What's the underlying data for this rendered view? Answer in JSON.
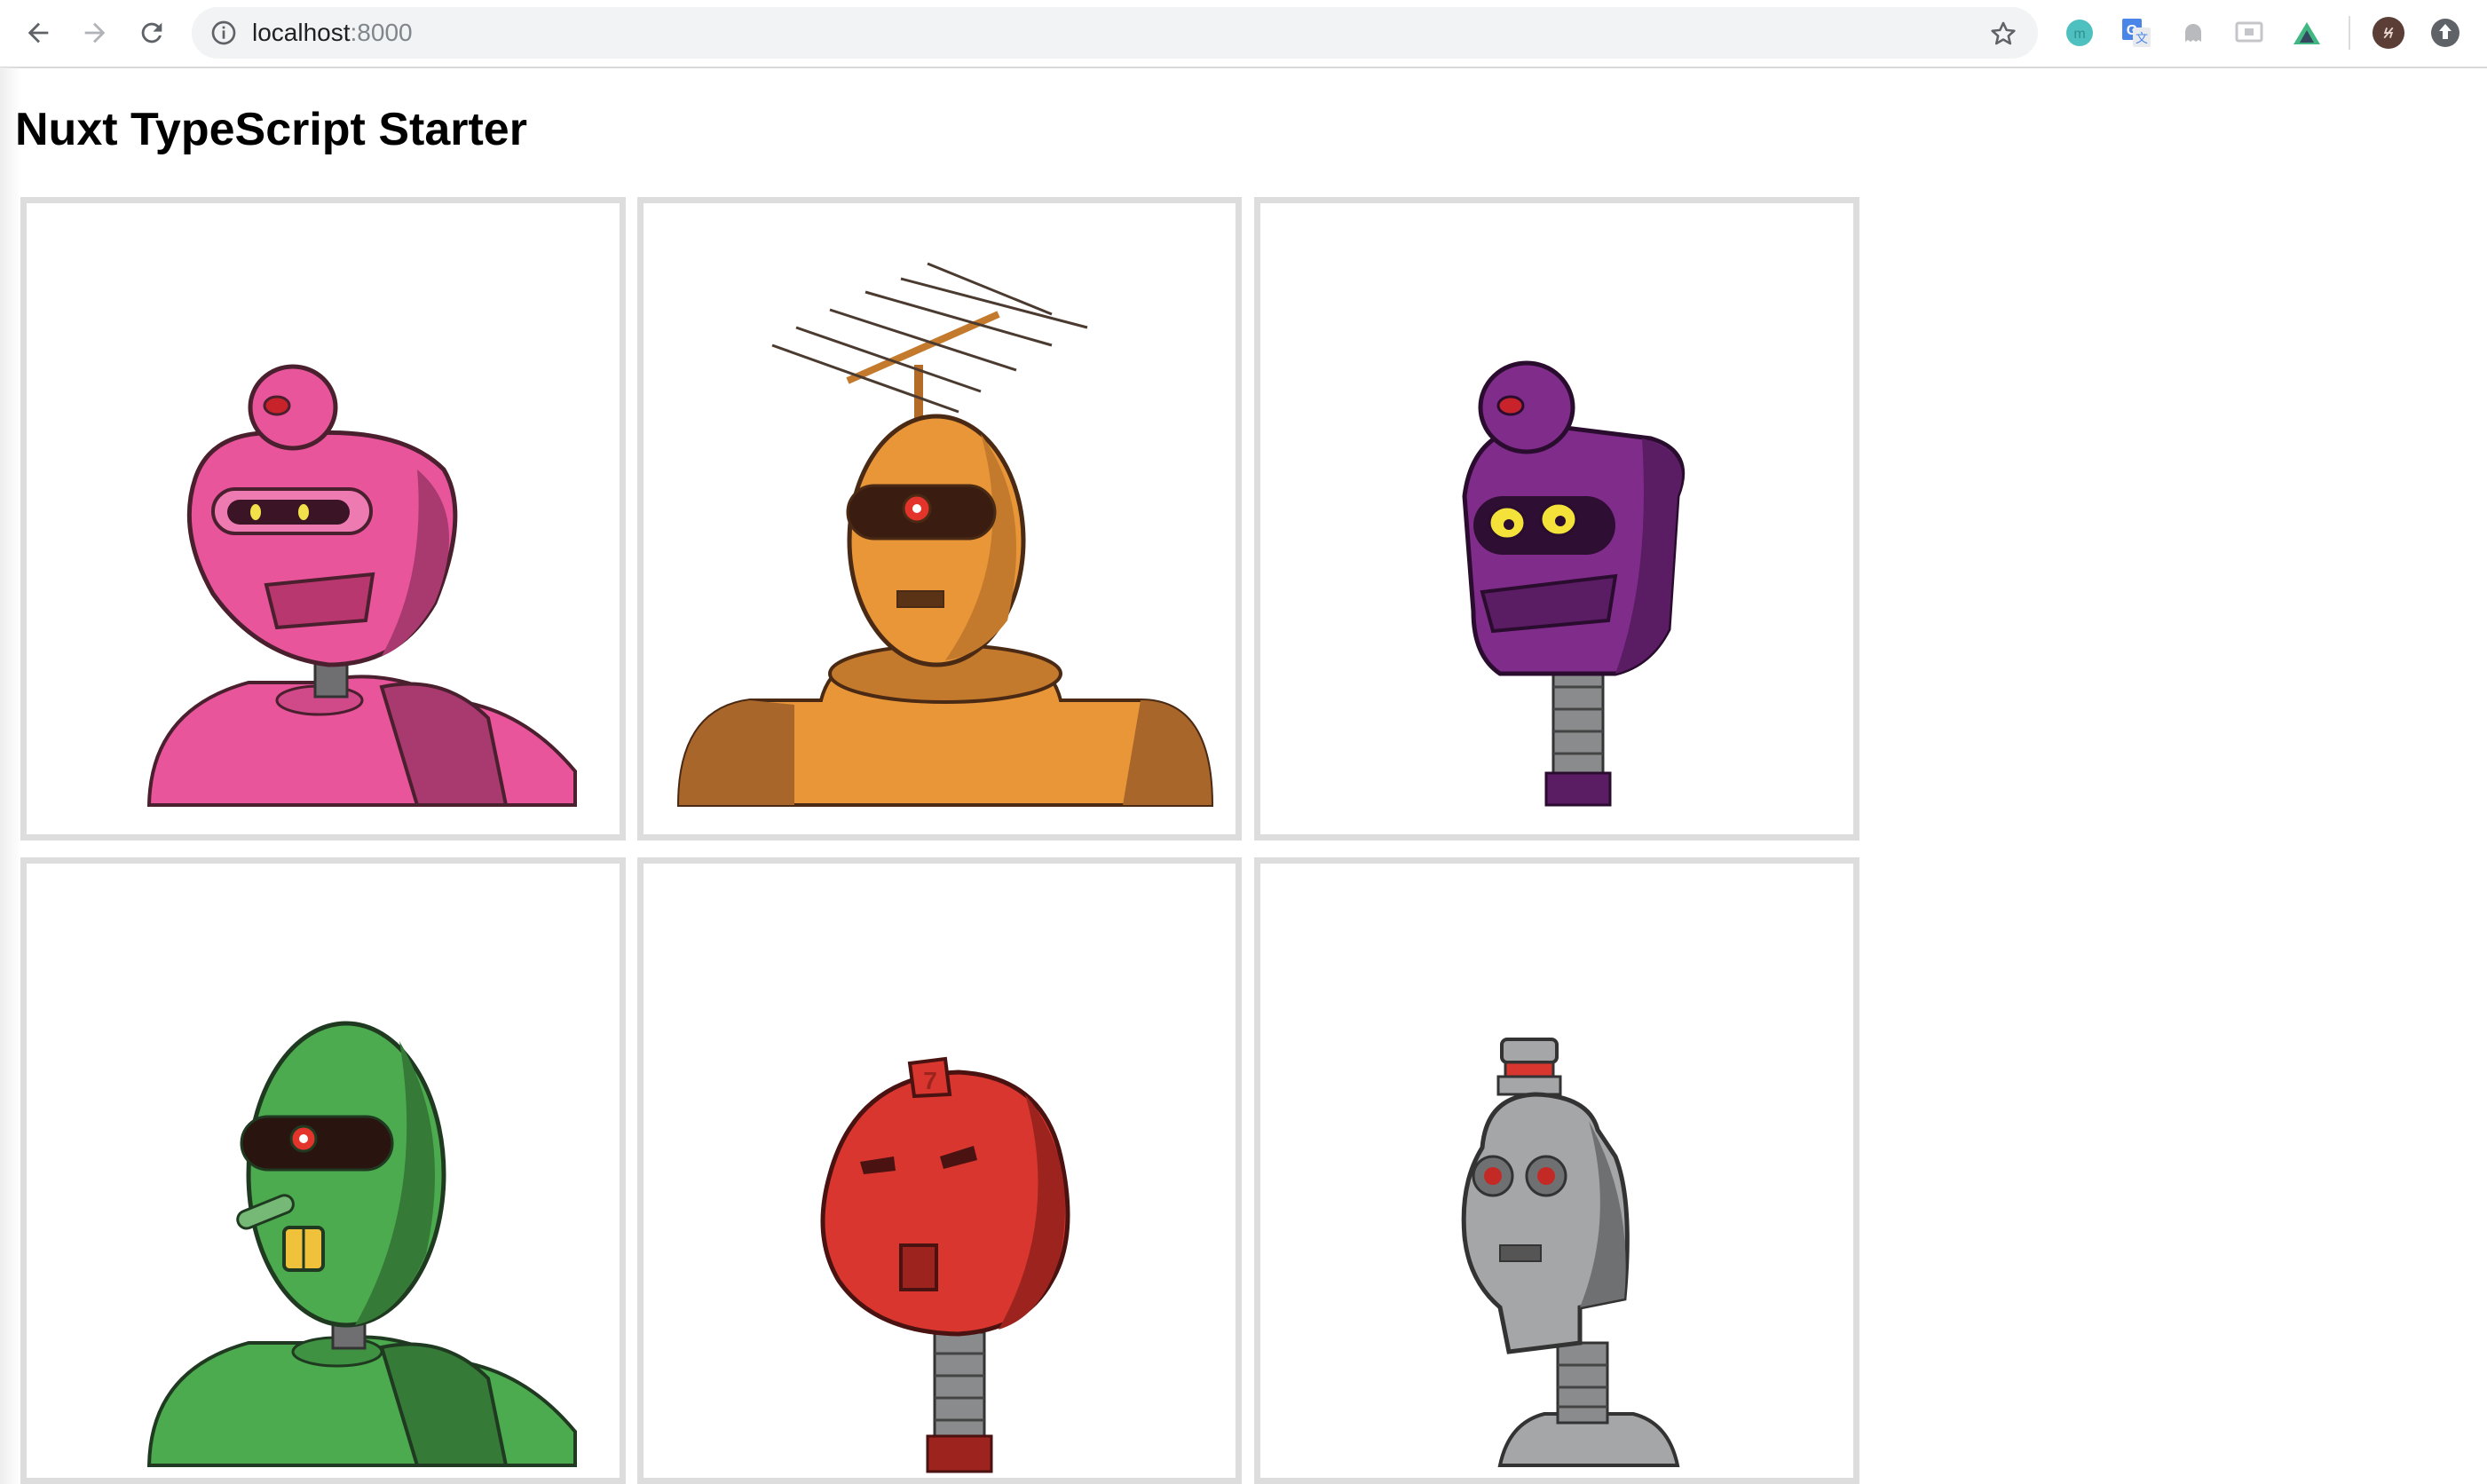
{
  "browser": {
    "url_host": "localhost",
    "url_port": ":8000",
    "extensions": [
      "m-extension-icon",
      "google-translate-icon",
      "ghost-extension-icon",
      "cast-extension-icon",
      "vue-devtools-icon",
      "profile-avatar",
      "update-icon"
    ]
  },
  "page": {
    "title": "Nuxt TypeScript Starter"
  },
  "robots": [
    {
      "name": "pink-robot",
      "color": "#e8559b",
      "dark": "#a83a6f"
    },
    {
      "name": "orange-robot",
      "color": "#e99638",
      "dark": "#a9662a"
    },
    {
      "name": "purple-robot",
      "color": "#7f2c8a",
      "dark": "#5a1c63"
    },
    {
      "name": "green-robot",
      "color": "#4caa4f",
      "dark": "#357a37"
    },
    {
      "name": "red-robot",
      "color": "#d8362e",
      "dark": "#9c231e"
    },
    {
      "name": "gray-robot",
      "color": "#a5a6a8",
      "dark": "#6f7072"
    }
  ]
}
